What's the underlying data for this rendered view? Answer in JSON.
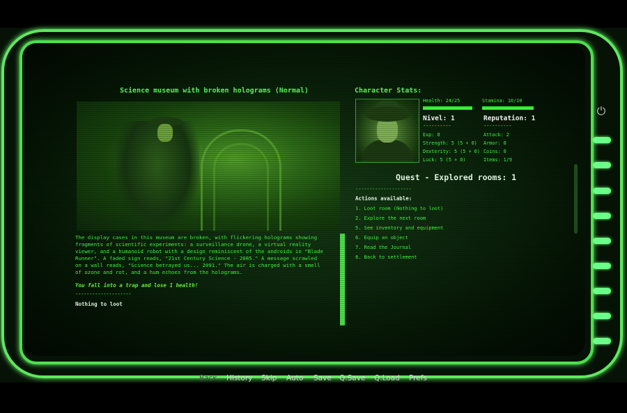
{
  "room": {
    "title": "Science museum with broken holograms (Normal)",
    "description": "The display cases in this museum are broken, with flickering holograms showing fragments of scientific experiments: a surveillance drone, a virtual reality viewer, and a humanoid robot with a design reminiscent of the androids in \"Blade Runner\". A faded sign reads, \"21st Century Science - 2085.\" A message scrawled on a wall reads, \"Science betrayed us... 2091.\" The air is charged with a smell of ozone and rot, and a hum echoes from the holograms.",
    "event": "You fall into a trap and lose 1 health!",
    "separator": "--------------------",
    "loot_result": "Nothing to loot"
  },
  "stats": {
    "title": "Character Stats:",
    "health_label": "Health: 24/25",
    "health_fraction": 0.96,
    "stamina_label": "Stamina: 10/10",
    "stamina_fraction": 1.0,
    "level": "Nivel: 1",
    "reputation": "Reputation: 1",
    "left_sep": "----------",
    "right_sep": "----------",
    "exp": "Exp: 0",
    "strength": "Strength: 5 (5 + 0)",
    "dexterity": "Dexterity: 5 (5 + 0)",
    "luck": "Luck: 5 (5 + 0)",
    "attack": "Attack: 2",
    "armor": "Armor: 0",
    "coins": "Coins: 0",
    "items": "Items: 1/9"
  },
  "quest": {
    "label": "Quest - Explored rooms: 1",
    "separator": "--------------------"
  },
  "actions": {
    "title": "Actions available:",
    "items": [
      "1. Loot room (Nothing to loot)",
      "2. Explore the next room",
      "5. See inventory and equipment",
      "6. Equip an object",
      "7. Read the Journal",
      "8. Back to settlement"
    ]
  },
  "menu": {
    "back": "Back",
    "history": "History",
    "skip": "Skip",
    "auto": "Auto",
    "save": "Save",
    "qsave": "Q.Save",
    "qload": "Q.Load",
    "prefs": "Prefs"
  },
  "colors": {
    "phosphor": "#42ff42",
    "highlight": "#e8ffe8",
    "frame": "#7dff7d"
  },
  "icons": {
    "power": "power-icon"
  }
}
